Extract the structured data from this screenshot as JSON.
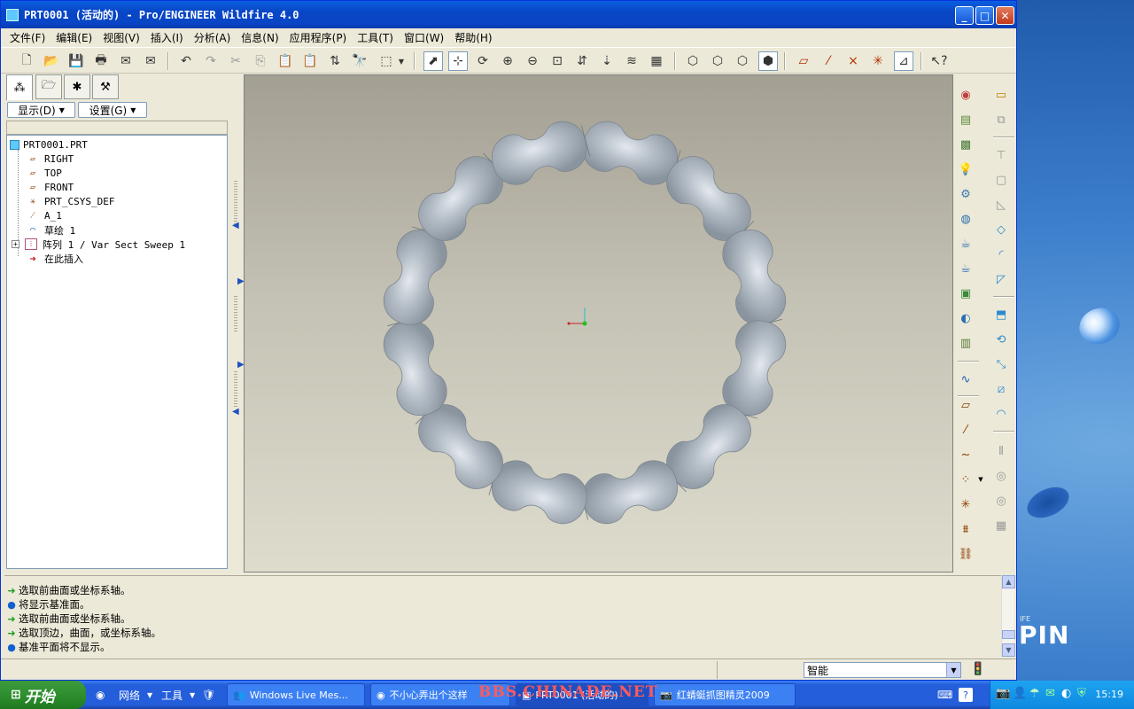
{
  "window": {
    "title": "PRT0001 (活动的) - Pro/ENGINEER Wildfire 4.0"
  },
  "menu": [
    "文件(F)",
    "编辑(E)",
    "视图(V)",
    "插入(I)",
    "分析(A)",
    "信息(N)",
    "应用程序(P)",
    "工具(T)",
    "窗口(W)",
    "帮助(H)"
  ],
  "panel": {
    "show_label": "显示(D)",
    "settings_label": "设置(G)"
  },
  "tree": {
    "root": "PRT0001.PRT",
    "items": [
      "RIGHT",
      "TOP",
      "FRONT",
      "PRT_CSYS_DEF",
      "A_1",
      "草绘 1",
      "阵列 1 / Var Sect Sweep 1",
      "在此插入"
    ]
  },
  "messages": [
    "选取前曲面或坐标系轴。",
    "将显示基准面。",
    "选取前曲面或坐标系轴。",
    "选取顶边，曲面，或坐标系轴。",
    "基准平面将不显示。"
  ],
  "status": {
    "filter": "智能"
  },
  "desktop": {
    "brand_small": "IFE",
    "brand_large": "PIN"
  },
  "taskbar": {
    "start": "开始",
    "network": "网络",
    "tools": "工具",
    "tasks": [
      "Windows Live Mes...",
      "不小心弄出个这样",
      "PRT0001 (活动的)",
      "红蜻蜓抓图精灵2009"
    ],
    "watermark": "BBS.CHINADE.NET",
    "clock": "15:19"
  },
  "colors": {
    "titlebar": "#0846c6",
    "model": "#a9b3be",
    "viewport_top": "#a39f93",
    "viewport_bottom": "#dddccd"
  }
}
